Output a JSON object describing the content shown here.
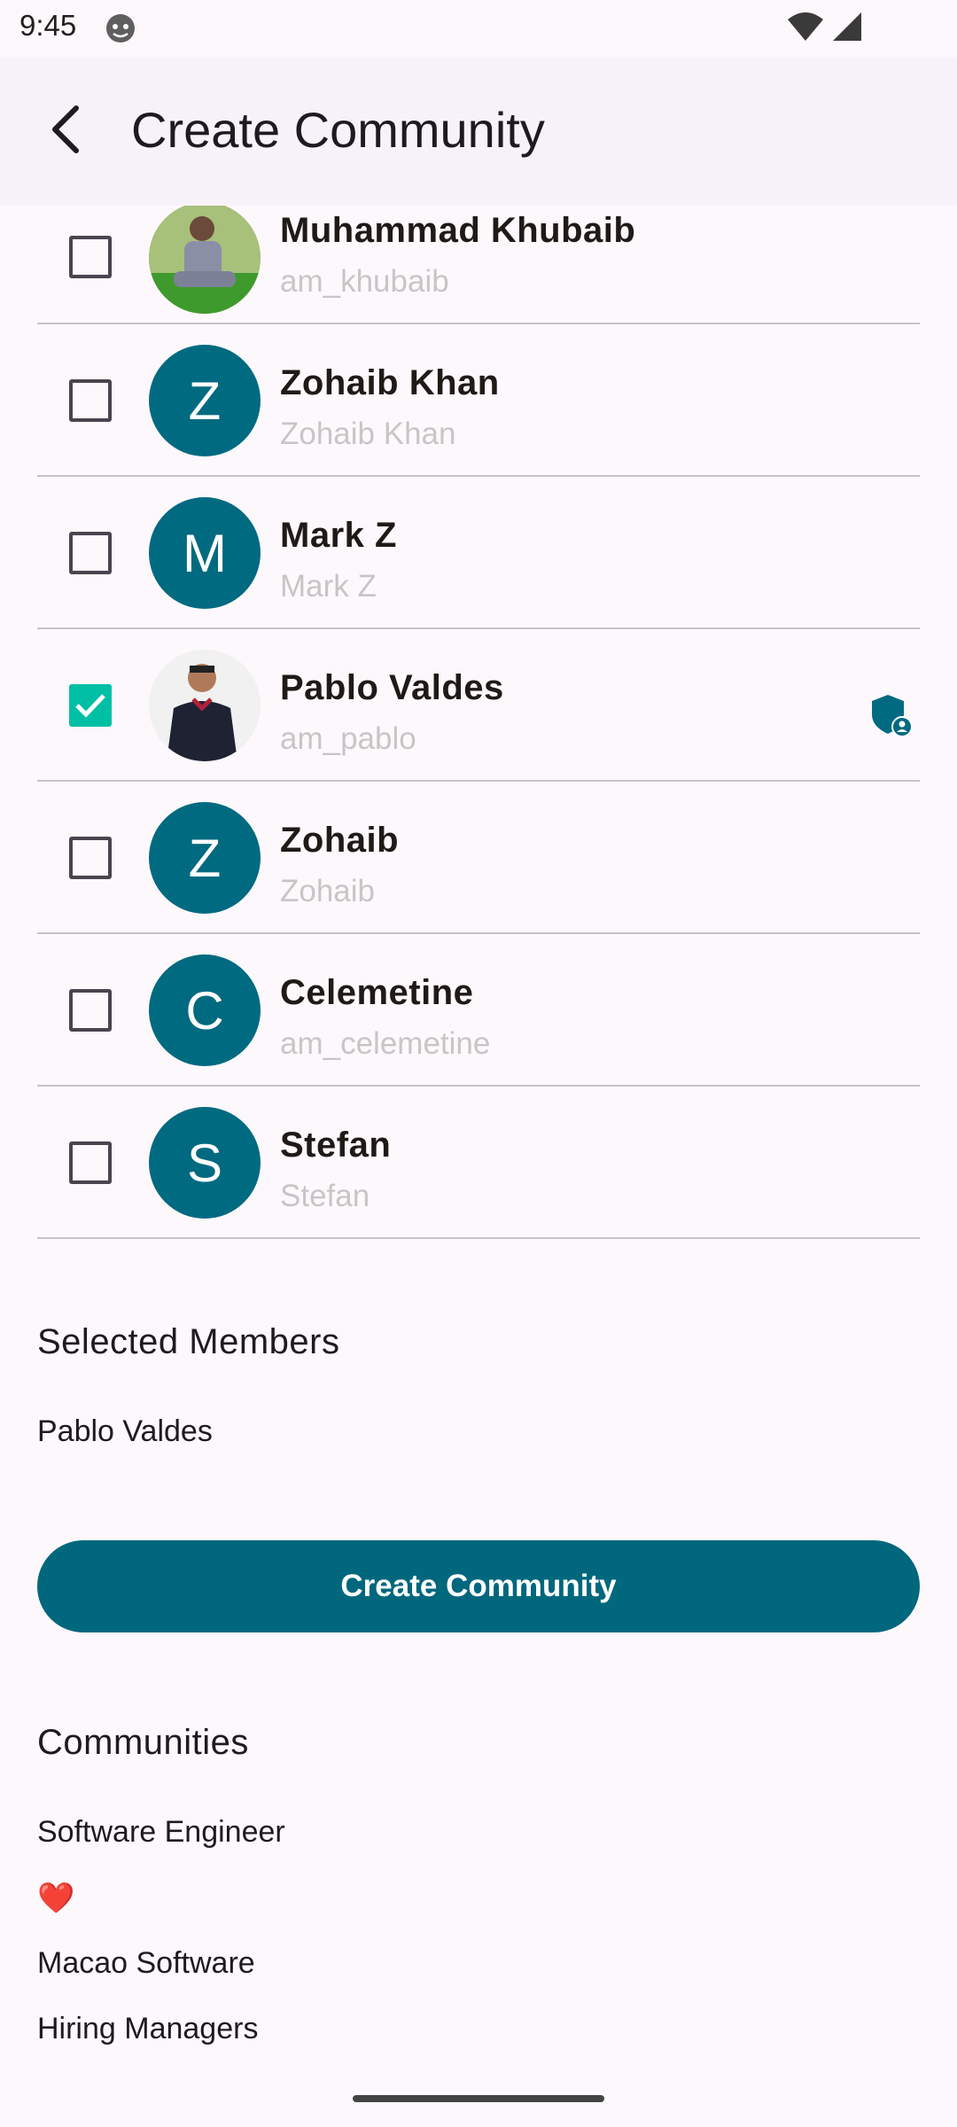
{
  "status_bar": {
    "time": "9:45"
  },
  "app_bar": {
    "title": "Create Community"
  },
  "members": [
    {
      "name": "Muhammad Khubaib",
      "handle": "am_khubaib",
      "checked": false,
      "avatar": "photo"
    },
    {
      "name": "Zohaib Khan",
      "handle": "Zohaib Khan",
      "checked": false,
      "initial": "Z"
    },
    {
      "name": "Mark Z",
      "handle": "Mark Z",
      "checked": false,
      "initial": "M"
    },
    {
      "name": "Pablo Valdes",
      "handle": "am_pablo",
      "checked": true,
      "avatar": "photo",
      "admin_icon": "admin-shield-icon"
    },
    {
      "name": "Zohaib",
      "handle": "Zohaib",
      "checked": false,
      "initial": "Z"
    },
    {
      "name": "Celemetine",
      "handle": "am_celemetine",
      "checked": false,
      "initial": "C"
    },
    {
      "name": "Stefan",
      "handle": "Stefan",
      "checked": false,
      "initial": "S"
    }
  ],
  "selected_members": {
    "title": "Selected Members",
    "items": [
      "Pablo Valdes"
    ]
  },
  "create_button": {
    "label": "Create Community"
  },
  "communities": {
    "title": "Communities",
    "items": [
      "Software Engineer",
      "❤️",
      "Macao Software",
      "Hiring Managers"
    ]
  },
  "colors": {
    "accent": "#00677d",
    "avatar_bg": "#006a80",
    "check": "#00bfa5"
  }
}
